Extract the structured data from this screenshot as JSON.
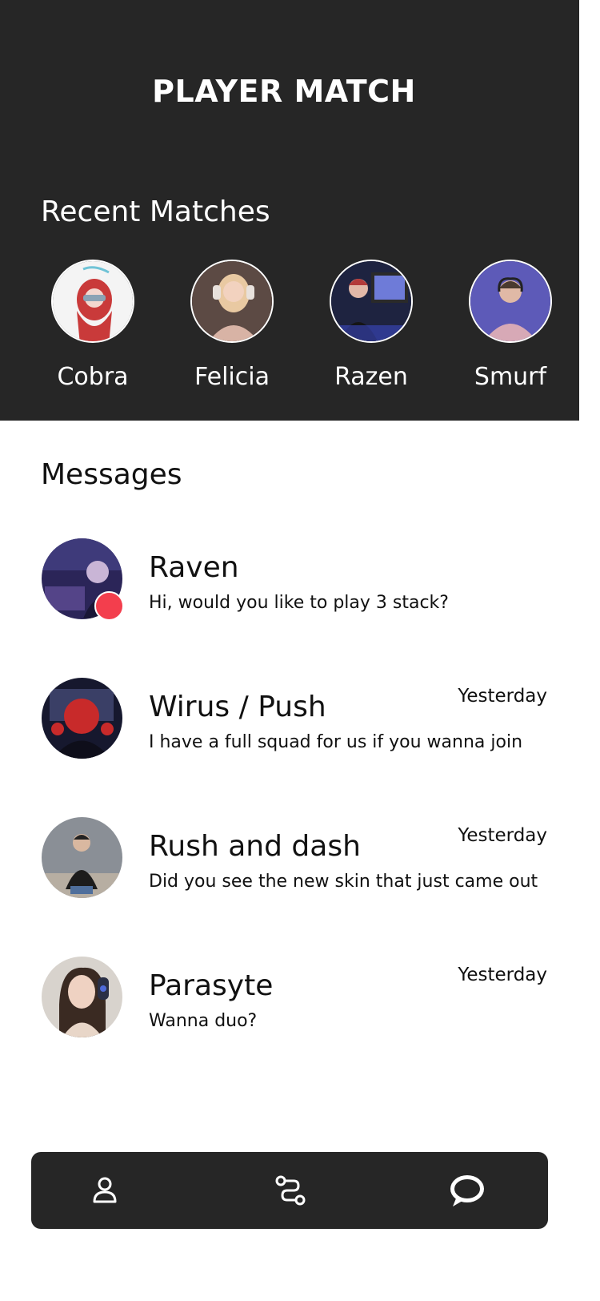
{
  "app": {
    "title": "PLAYER MATCH"
  },
  "recent": {
    "title": "Recent Matches",
    "matches": [
      {
        "name": "Cobra",
        "avatar": "cobra-avatar"
      },
      {
        "name": "Felicia",
        "avatar": "felicia-avatar"
      },
      {
        "name": "Razen",
        "avatar": "razen-avatar"
      },
      {
        "name": "Smurf",
        "avatar": "smurf-avatar"
      }
    ]
  },
  "messages": {
    "title": "Messages",
    "items": [
      {
        "sender": "Raven",
        "time": "",
        "preview": "Hi, would you like to play 3 stack?",
        "unread": true
      },
      {
        "sender": "Wirus / Push",
        "time": "Yesterday",
        "preview": "I have a full squad for us if you wanna join",
        "unread": false
      },
      {
        "sender": "Rush and dash",
        "time": "Yesterday",
        "preview": "Did you see the new skin that just came out",
        "unread": false
      },
      {
        "sender": "Parasyte",
        "time": "Yesterday",
        "preview": "Wanna duo?",
        "unread": false
      }
    ]
  },
  "nav": {
    "items": [
      {
        "icon": "profile-icon"
      },
      {
        "icon": "route-icon"
      },
      {
        "icon": "chat-icon",
        "active": true
      }
    ]
  },
  "colors": {
    "header_bg": "#262626",
    "unread_dot": "#f33e4d",
    "text_light": "#ffffff",
    "text_dark": "#111111"
  }
}
